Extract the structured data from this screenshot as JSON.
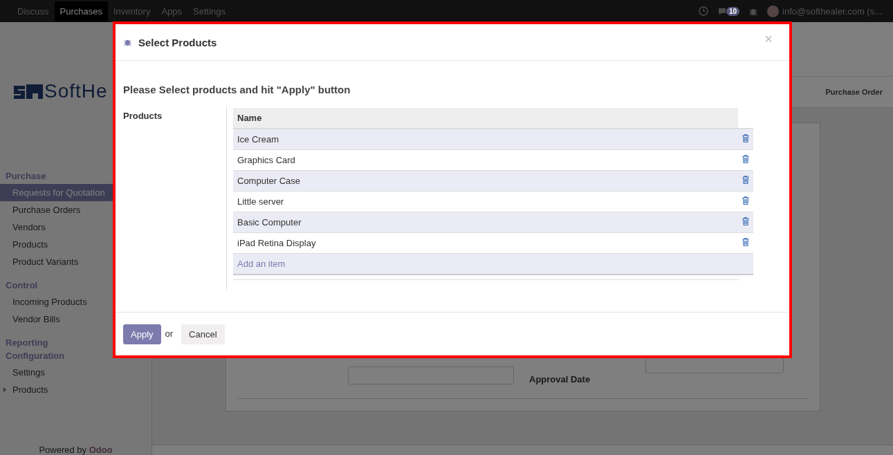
{
  "navbar": {
    "apps": [
      {
        "label": "Discuss",
        "selected": false
      },
      {
        "label": "Purchases",
        "selected": true
      },
      {
        "label": "Inventory",
        "selected": false
      },
      {
        "label": "Apps",
        "selected": false
      },
      {
        "label": "Settings",
        "selected": false
      }
    ],
    "messages_count": "10",
    "user": "info@softhealer.com (s..."
  },
  "logo": {
    "text": "SoftHe"
  },
  "sidebar": [
    {
      "title": "Purchase",
      "items": [
        {
          "label": "Requests for Quotation",
          "selected": true,
          "kind": "link"
        },
        {
          "label": "Purchase Orders",
          "selected": false,
          "kind": "link"
        },
        {
          "label": "Vendors",
          "selected": false,
          "kind": "link"
        },
        {
          "label": "Products",
          "selected": false,
          "kind": "link"
        },
        {
          "label": "Product Variants",
          "selected": false,
          "kind": "link"
        }
      ]
    },
    {
      "title": "Control",
      "items": [
        {
          "label": "Incoming Products",
          "selected": false,
          "kind": "link"
        },
        {
          "label": "Vendor Bills",
          "selected": false,
          "kind": "link"
        }
      ]
    },
    {
      "title": "Reporting Configuration",
      "items": [
        {
          "label": "Settings",
          "selected": false,
          "kind": "link"
        },
        {
          "label": "Products",
          "selected": false,
          "kind": "group"
        }
      ]
    }
  ],
  "powered_by": {
    "text": "Powered by",
    "brand": "Odoo"
  },
  "breadcrumb": "Purchase Order",
  "form": {
    "approval_label": "Approval Date"
  },
  "dialog": {
    "title": "Select Products",
    "close": "×",
    "instruction": "Please Select products and hit \"Apply\" button",
    "field_label": "Products",
    "table": {
      "columns": [
        "Name"
      ],
      "rows": [
        "Ice Cream",
        "Graphics Card",
        "Computer Case",
        "Little server",
        "Basic Computer",
        "iPad Retina Display"
      ],
      "add_item": "Add an item"
    },
    "apply": "Apply",
    "or": "or",
    "cancel": "Cancel"
  }
}
